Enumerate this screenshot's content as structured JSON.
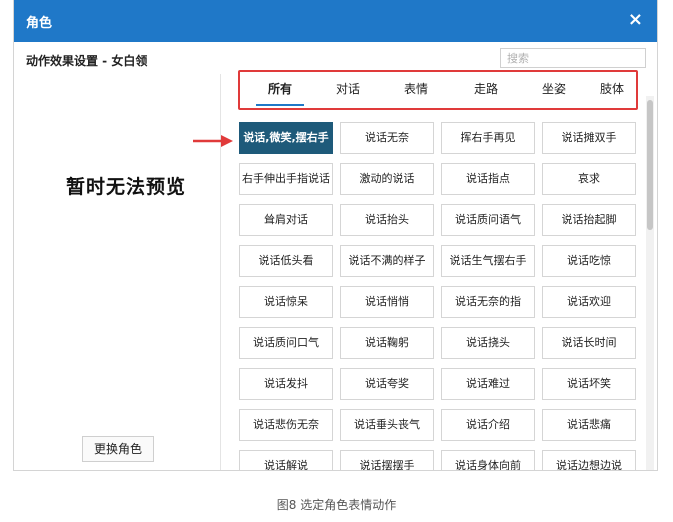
{
  "dialog": {
    "title": "角色",
    "close": "×",
    "subtitle": "动作效果设置 - 女白领",
    "search_placeholder": "搜索"
  },
  "preview": {
    "message": "暂时无法预览",
    "change_button": "更换角色"
  },
  "tabs": [
    {
      "label": "所有",
      "active": true
    },
    {
      "label": "对话",
      "active": false
    },
    {
      "label": "表情",
      "active": false
    },
    {
      "label": "走路",
      "active": false
    },
    {
      "label": "坐姿",
      "active": false
    },
    {
      "label": "肢体",
      "active": false
    }
  ],
  "actions": [
    {
      "label": "说话,微笑,摆右手",
      "selected": true
    },
    {
      "label": "说话无奈",
      "selected": false
    },
    {
      "label": "挥右手再见",
      "selected": false
    },
    {
      "label": "说话摊双手",
      "selected": false
    },
    {
      "label": "右手伸出手指说话",
      "selected": false
    },
    {
      "label": "激动的说话",
      "selected": false
    },
    {
      "label": "说话指点",
      "selected": false
    },
    {
      "label": "哀求",
      "selected": false
    },
    {
      "label": "耸肩对话",
      "selected": false
    },
    {
      "label": "说话抬头",
      "selected": false
    },
    {
      "label": "说话质问语气",
      "selected": false
    },
    {
      "label": "说话抬起脚",
      "selected": false
    },
    {
      "label": "说话低头看",
      "selected": false
    },
    {
      "label": "说话不满的样子",
      "selected": false
    },
    {
      "label": "说话生气摆右手",
      "selected": false
    },
    {
      "label": "说话吃惊",
      "selected": false
    },
    {
      "label": "说话惊呆",
      "selected": false
    },
    {
      "label": "说话悄悄",
      "selected": false
    },
    {
      "label": "说话无奈的指",
      "selected": false
    },
    {
      "label": "说话欢迎",
      "selected": false
    },
    {
      "label": "说话质问口气",
      "selected": false
    },
    {
      "label": "说话鞠躬",
      "selected": false
    },
    {
      "label": "说话挠头",
      "selected": false
    },
    {
      "label": "说话长时间",
      "selected": false
    },
    {
      "label": "说话发抖",
      "selected": false
    },
    {
      "label": "说话夸奖",
      "selected": false
    },
    {
      "label": "说话难过",
      "selected": false
    },
    {
      "label": "说话坏笑",
      "selected": false
    },
    {
      "label": "说话悲伤无奈",
      "selected": false
    },
    {
      "label": "说话垂头丧气",
      "selected": false
    },
    {
      "label": "说话介绍",
      "selected": false
    },
    {
      "label": "说话悲痛",
      "selected": false
    },
    {
      "label": "说话解说",
      "selected": false
    },
    {
      "label": "说话摆摆手",
      "selected": false
    },
    {
      "label": "说话身体向前",
      "selected": false
    },
    {
      "label": "说话边想边说",
      "selected": false
    }
  ],
  "caption": "图8 选定角色表情动作",
  "colors": {
    "titlebar": "#1f78c8",
    "selected_card": "#1e5a7a",
    "highlight": "#e03a3a"
  }
}
